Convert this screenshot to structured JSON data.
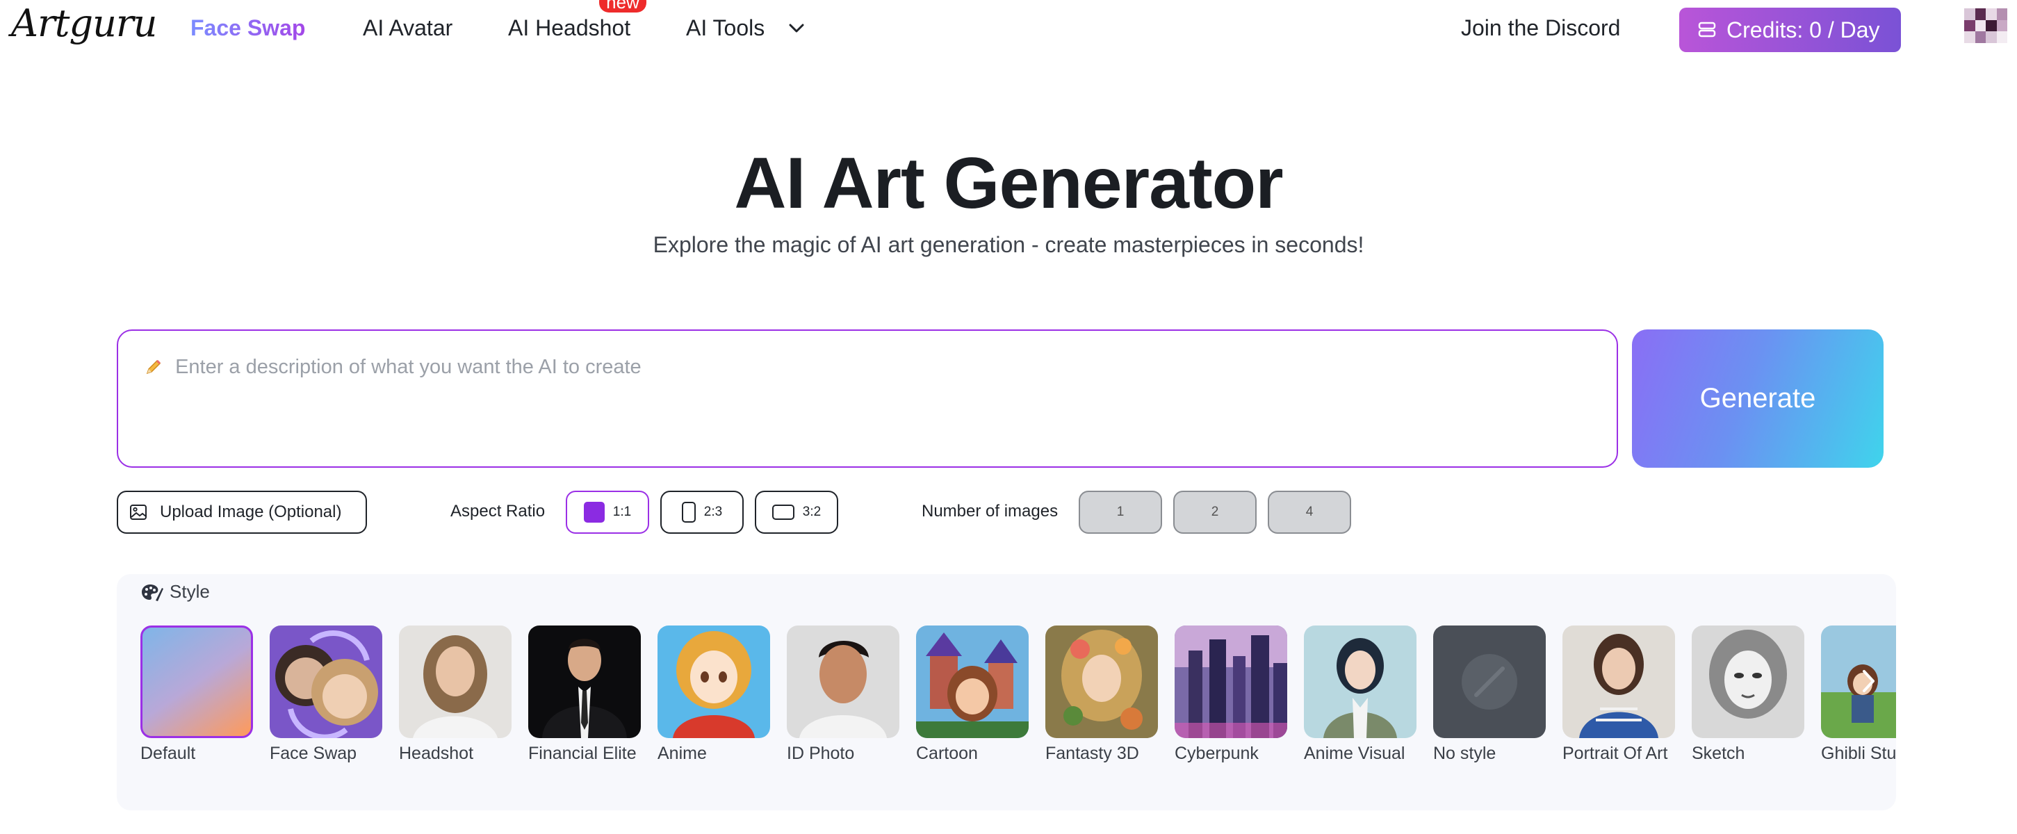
{
  "nav": {
    "logo": "Artguru",
    "links": [
      {
        "label": "Face Swap"
      },
      {
        "label": "AI Avatar"
      },
      {
        "label": "AI Headshot"
      },
      {
        "label": "AI Tools"
      }
    ],
    "new_badge": "new",
    "discord": "Join the Discord",
    "credits": "Credits: 0 / Day"
  },
  "hero": {
    "title": "AI Art Generator",
    "subtitle": "Explore the magic of AI art generation - create masterpieces in seconds!"
  },
  "prompt": {
    "placeholder": "Enter a description of what you want the AI to create",
    "icon": "pencil-icon",
    "generate": "Generate"
  },
  "options": {
    "upload": "Upload Image (Optional)",
    "aspect_label": "Aspect Ratio",
    "ratios": [
      "1:1",
      "2:3",
      "3:2"
    ],
    "selected_ratio": "1:1",
    "num_label": "Number of images",
    "nums": [
      "1",
      "2",
      "4"
    ]
  },
  "styles": {
    "heading": "Style",
    "selected": "Default",
    "items": [
      {
        "label": "Default"
      },
      {
        "label": "Face Swap"
      },
      {
        "label": "Headshot"
      },
      {
        "label": "Financial Elite"
      },
      {
        "label": "Anime"
      },
      {
        "label": "ID Photo"
      },
      {
        "label": "Cartoon"
      },
      {
        "label": "Fantasty 3D"
      },
      {
        "label": "Cyberpunk"
      },
      {
        "label": "Anime Visual"
      },
      {
        "label": "No style"
      },
      {
        "label": "Portrait Of Art"
      },
      {
        "label": "Sketch"
      },
      {
        "label": "Ghibli Studio"
      }
    ]
  },
  "colors": {
    "accent": "#9b30e6",
    "credits_gradient": [
      "#b955d8",
      "#7a52d6"
    ],
    "generate_gradient": [
      "#8a6ef5",
      "#3fd4ec"
    ],
    "new_badge": "#ee2b2b"
  }
}
